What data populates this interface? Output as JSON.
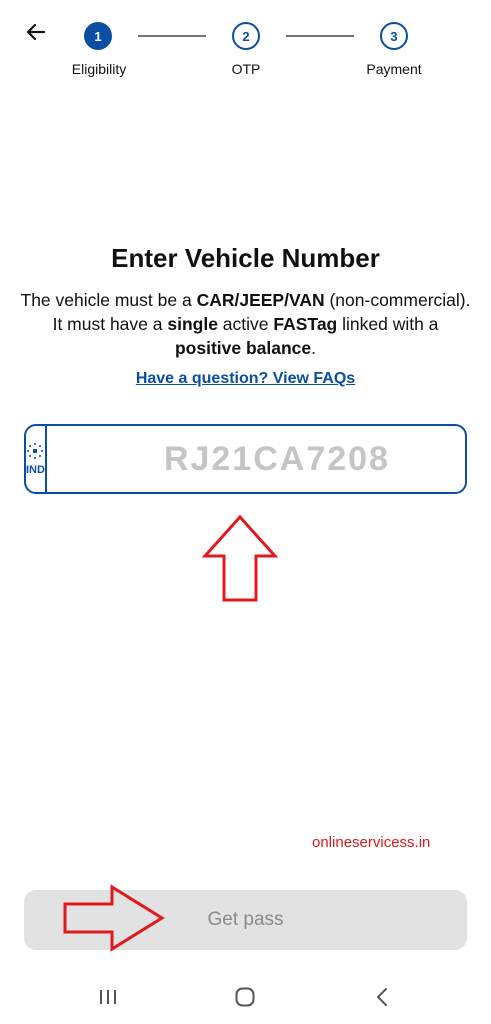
{
  "header": {
    "back_icon": "arrow-left-icon"
  },
  "stepper": {
    "steps": [
      {
        "number": "1",
        "label": "Eligibility",
        "state": "active"
      },
      {
        "number": "2",
        "label": "OTP",
        "state": "pending"
      },
      {
        "number": "3",
        "label": "Payment",
        "state": "pending"
      }
    ]
  },
  "main": {
    "title": "Enter Vehicle Number",
    "description": {
      "part1": "The vehicle must be a ",
      "bold1": "CAR/JEEP/VAN",
      "part2": " (non-commercial). It must have a ",
      "bold2": "single",
      "part3": " active ",
      "bold3": "FASTag",
      "part4": " linked with a ",
      "bold4": "positive balance",
      "part5": "."
    },
    "faq_link": "Have a question? View FAQs"
  },
  "vehicle_input": {
    "country_code": "IND",
    "value": "",
    "placeholder": "RJ21CA7208"
  },
  "watermark": "onlineservicess.in",
  "footer": {
    "get_pass_label": "Get pass"
  },
  "navbar": {
    "recents_icon": "recents-icon",
    "home_icon": "home-icon",
    "back_icon": "back-chevron-icon"
  },
  "colors": {
    "accent": "#0b4ea2",
    "annotation": "#e0191d",
    "disabled_bg": "#e2e2e2",
    "disabled_text": "#8a8a8a"
  }
}
